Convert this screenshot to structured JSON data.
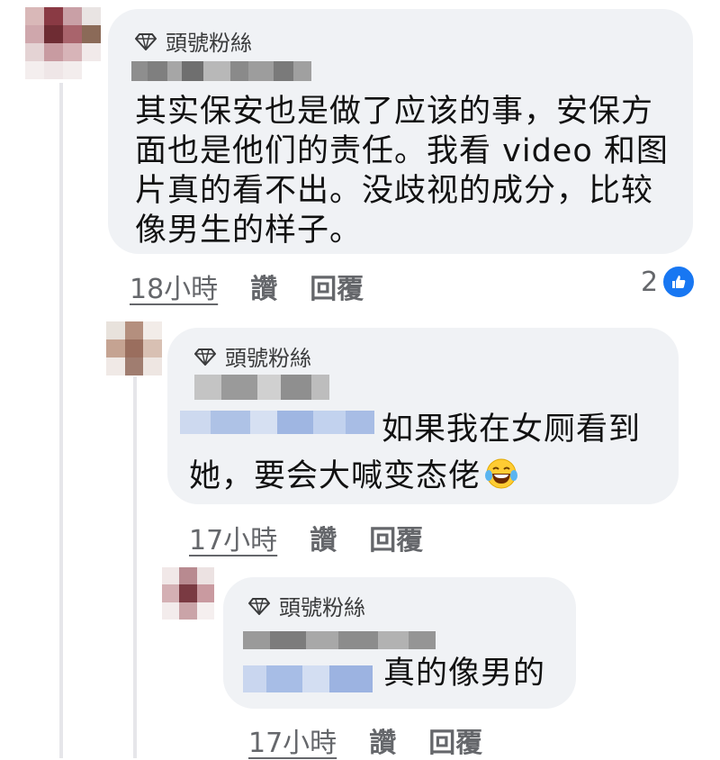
{
  "comments": [
    {
      "badge": "頭號粉絲",
      "text": "其实保安也是做了应该的事，安保方面也是他们的责任。我看 video 和图片真的看不出。没歧视的成分，比较像男生的样子。",
      "time": "18小時",
      "like_label": "讚",
      "reply_label": "回覆",
      "reaction_count": "2",
      "reaction_icon": "like-icon"
    },
    {
      "badge": "頭號粉絲",
      "text_line1": "如果我在女厕看到",
      "text_line2": "她，要会大喊变态佬",
      "emoji": "laughing-crying-emoji",
      "time": "17小時",
      "like_label": "讚",
      "reply_label": "回覆"
    },
    {
      "badge": "頭號粉絲",
      "text": "真的像男的",
      "time": "17小時",
      "like_label": "讚",
      "reply_label": "回覆"
    }
  ],
  "colors": {
    "bubble": "#f0f2f5",
    "meta_text": "#65676b",
    "like_blue": "#1877f2"
  }
}
